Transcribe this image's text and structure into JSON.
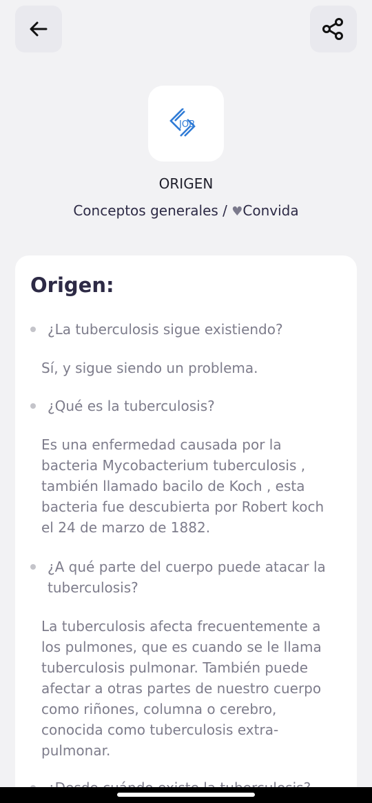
{
  "header": {
    "back_icon": "arrow-left-icon",
    "share_icon": "share-icon"
  },
  "company": {
    "logo_text": "JOB",
    "logo_color": "#2f7bd6",
    "name": "ORIGEN"
  },
  "breadcrumb": {
    "category": "Conceptos generales",
    "separator": " / ",
    "heart": "♥",
    "brand": "Convida"
  },
  "card": {
    "title": "Origen:",
    "items": [
      {
        "question": "¿La tuberculosis sigue existiendo?",
        "answer": "Sí, y sigue siendo un problema."
      },
      {
        "question": "¿Qué es la tuberculosis?",
        "answer": "Es una enfermedad causada por la bacteria Mycobacterium tuberculosis , también llamado bacilo de Koch , esta bacteria fue descubierta por Robert koch el 24 de marzo de 1882."
      },
      {
        "question": "¿A qué parte del cuerpo puede atacar la tuberculosis?",
        "answer": "La tuberculosis afecta frecuentemente a los pulmones, que es cuando se le llama tuberculosis pulmonar. También puede afectar a otras partes de nuestro cuerpo como riñones, columna o cerebro, conocida como tuberculosis extra-pulmonar."
      },
      {
        "question": "¿Desde cuándo existe la tuberculosis?",
        "answer": ""
      }
    ]
  }
}
